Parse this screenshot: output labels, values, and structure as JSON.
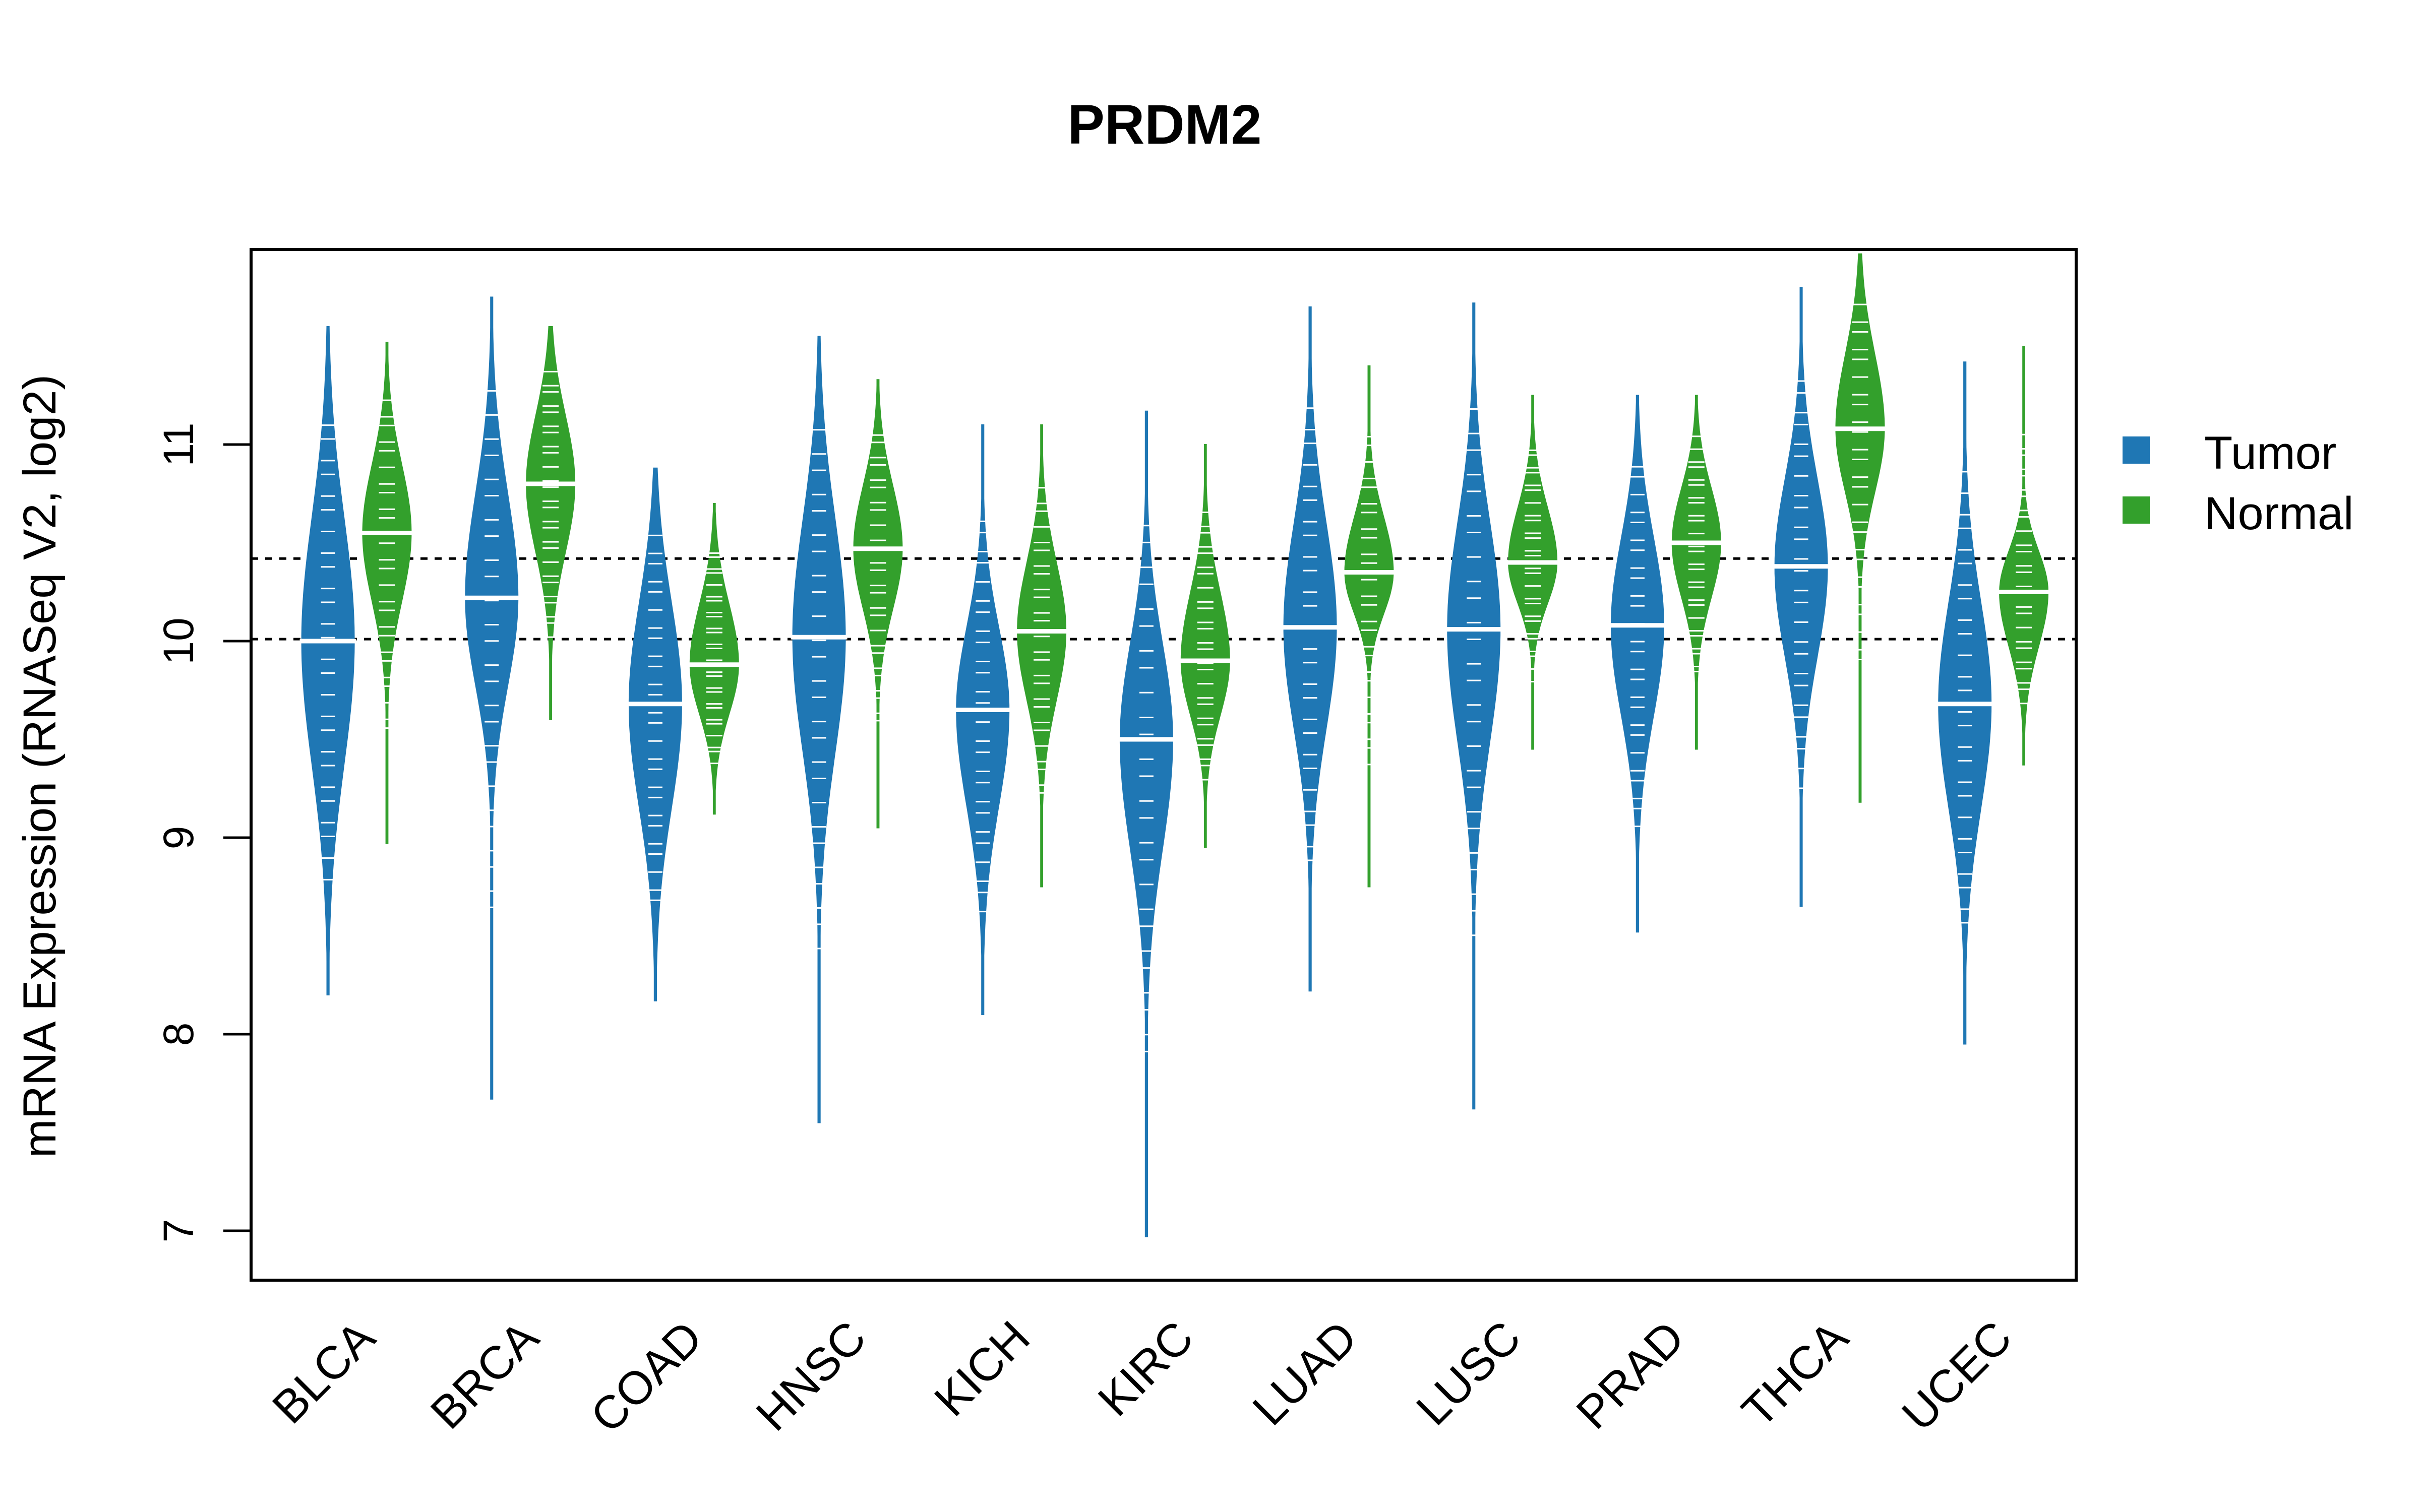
{
  "chart_data": {
    "type": "violin",
    "title": "PRDM2",
    "xlabel": "",
    "ylabel": "mRNA Expression (RNASeq V2, log2)",
    "ylim": [
      6.8,
      12.0
    ],
    "yticks": [
      "7",
      "8",
      "9",
      "10",
      "11"
    ],
    "grid": false,
    "reference_lines": [
      10.42,
      10.01
    ],
    "legend": {
      "placement": "right",
      "entries": [
        {
          "name": "Tumor",
          "color": "#1f77b4"
        },
        {
          "name": "Normal",
          "color": "#33a02c"
        }
      ]
    },
    "categories": [
      "BLCA",
      "BRCA",
      "COAD",
      "HNSC",
      "KICH",
      "KIRC",
      "LUAD",
      "LUSC",
      "PRAD",
      "THCA",
      "UCEC"
    ],
    "series": [
      {
        "name": "Tumor",
        "color": "#1f77b4",
        "median": [
          10.0,
          10.22,
          9.68,
          10.02,
          9.65,
          9.5,
          10.07,
          10.06,
          10.08,
          10.38,
          9.68
        ],
        "q1": [
          9.55,
          9.9,
          9.3,
          9.6,
          9.3,
          9.1,
          9.7,
          9.65,
          9.75,
          10.05,
          9.3
        ],
        "q3": [
          10.45,
          10.6,
          10.05,
          10.45,
          9.95,
          9.85,
          10.45,
          10.45,
          10.4,
          10.7,
          10.05
        ],
        "min": [
          8.2,
          7.67,
          8.17,
          7.55,
          8.1,
          6.97,
          8.22,
          7.62,
          8.52,
          8.65,
          7.95
        ],
        "max": [
          11.6,
          11.75,
          10.88,
          11.55,
          11.1,
          11.17,
          11.7,
          11.72,
          11.25,
          11.8,
          11.42
        ]
      },
      {
        "name": "Normal",
        "color": "#33a02c",
        "median": [
          10.55,
          10.8,
          9.88,
          10.47,
          10.05,
          9.9,
          10.35,
          10.4,
          10.5,
          11.08,
          10.25
        ],
        "q1": [
          10.3,
          10.55,
          9.7,
          10.25,
          9.8,
          9.7,
          10.2,
          10.25,
          10.3,
          10.85,
          10.05
        ],
        "q3": [
          10.8,
          11.05,
          10.1,
          10.7,
          10.3,
          10.15,
          10.55,
          10.6,
          10.7,
          11.35,
          10.4
        ],
        "min": [
          8.97,
          9.6,
          9.12,
          9.05,
          8.75,
          8.95,
          8.75,
          9.45,
          9.45,
          9.18,
          9.37
        ],
        "max": [
          11.52,
          11.6,
          10.7,
          11.33,
          11.1,
          11.0,
          11.4,
          11.25,
          11.25,
          11.97,
          11.5
        ]
      }
    ]
  }
}
